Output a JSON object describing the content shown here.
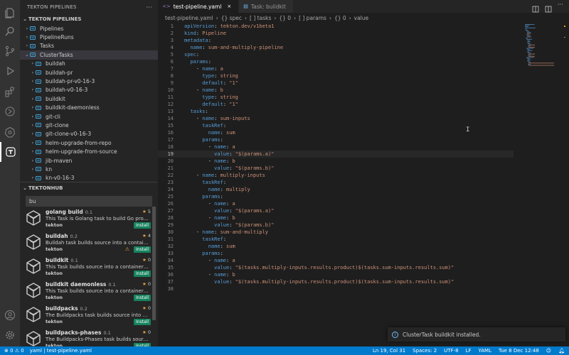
{
  "colors": {
    "accent": "#007acc",
    "install_badge": "#16825d",
    "star": "#e8a33d",
    "tree_icon": "#3ea3d8",
    "yaml_key": "#569cd6",
    "yaml_string": "#ce9178"
  },
  "sidebar": {
    "explorer_title": "TEKTON PIPELINES",
    "tree": [
      {
        "label": "Pipelines",
        "level": 1,
        "expanded": false
      },
      {
        "label": "PipelineRuns",
        "level": 1,
        "expanded": false
      },
      {
        "label": "Tasks",
        "level": 1,
        "expanded": false
      },
      {
        "label": "ClusterTasks",
        "level": 1,
        "expanded": true,
        "selected": true
      },
      {
        "label": "buildah",
        "level": 2
      },
      {
        "label": "buildah-pr",
        "level": 2
      },
      {
        "label": "buildah-pr-v0-16-3",
        "level": 2
      },
      {
        "label": "buildah-v0-16-3",
        "level": 2
      },
      {
        "label": "buildkit",
        "level": 2
      },
      {
        "label": "buildkit-daemonless",
        "level": 2
      },
      {
        "label": "git-cli",
        "level": 2
      },
      {
        "label": "git-clone",
        "level": 2
      },
      {
        "label": "git-clone-v0-16-3",
        "level": 2
      },
      {
        "label": "helm-upgrade-from-repo",
        "level": 2
      },
      {
        "label": "helm-upgrade-from-source",
        "level": 2
      },
      {
        "label": "jib-maven",
        "level": 2
      },
      {
        "label": "kn",
        "level": 2
      },
      {
        "label": "kn-v0-16-3",
        "level": 2
      }
    ],
    "hub": {
      "title": "TEKTONHUB",
      "search_value": "bu",
      "items": [
        {
          "name": "golang build",
          "version": "0.1",
          "rating": "5",
          "desc": "This Task is Golang task to build Go proj...",
          "publisher": "tekton",
          "install": "Install",
          "warning": false
        },
        {
          "name": "buildah",
          "version": "0.2",
          "rating": "4",
          "desc": "Buildah task builds source into a contain...",
          "publisher": "tekton",
          "install": "Install",
          "warning": true
        },
        {
          "name": "buildkit",
          "version": "0.1",
          "rating": "0",
          "desc": "This Task builds source into a container i...",
          "publisher": "tekton",
          "install": "Install",
          "warning": false
        },
        {
          "name": "buildkit daemonless",
          "version": "0.1",
          "rating": "0",
          "desc": "This Task builds source into a container i...",
          "publisher": "tekton",
          "install": "Install",
          "warning": false
        },
        {
          "name": "buildpacks",
          "version": "0.2",
          "rating": "0",
          "desc": "The Buildpacks task builds source into a ...",
          "publisher": "tekton",
          "install": "Install",
          "warning": false
        },
        {
          "name": "buildpacks-phases",
          "version": "0.1",
          "rating": "0",
          "desc": "The Buildpacks-Phases task builds source ...",
          "publisher": "tekton",
          "install": "Install",
          "warning": false
        }
      ]
    }
  },
  "editor": {
    "tabs": [
      {
        "label": "test-pipeline.yaml",
        "active": true
      },
      {
        "label": "Task: buildkit",
        "active": false
      }
    ],
    "breadcrumbs": [
      "test-pipeline.yaml",
      "{} spec",
      "[ ] tasks",
      "{} 0",
      "[ ] params",
      "{} 0",
      "value"
    ],
    "breadcrumb_seps": [
      "›",
      "›",
      "›",
      "›",
      "›",
      "›"
    ],
    "current_line": 19,
    "lines": [
      "apiVersion: tekton.dev/v1beta1",
      "kind: Pipeline",
      "metadata:",
      "  name: sum-and-multiply-pipeline",
      "spec:",
      "  params:",
      "    - name: a",
      "      type: string",
      "      default: \"1\"",
      "    - name: b",
      "      type: string",
      "      default: \"1\"",
      "  tasks:",
      "    - name: sum-inputs",
      "      taskRef:",
      "        name: sum",
      "      params:",
      "        - name: a",
      "          value: \"$(params.a)\"",
      "        - name: b",
      "          value: \"$(params.b)\"",
      "    - name: multiply-inputs",
      "      taskRef:",
      "        name: multiply",
      "      params:",
      "        - name: a",
      "          value: \"$(params.a)\"",
      "        - name: b",
      "          value: \"$(params.b)\"",
      "    - name: sum-and-multiply",
      "      taskRef:",
      "        name: sum",
      "      params:",
      "        - name: a",
      "          value: \"$(tasks.multiply-inputs.results.product)$(tasks.sum-inputs.results.sum)\"",
      "        - name: b",
      "          value: \"$(tasks.multiply-inputs.results.product)$(tasks.sum-inputs.results.sum)\"",
      ""
    ]
  },
  "notification": {
    "text": "ClusterTask buildkit installed."
  },
  "statusbar": {
    "problems": "⊗ 0 ⚠ 0",
    "language_file": "yaml | test-pipeline.yaml",
    "cursor": "Ln 19, Col 31",
    "spaces": "Spaces: 2",
    "encoding": "UTF-8",
    "eol": "LF",
    "language": "YAML",
    "clock": "Tue 8 Dec 12:48"
  }
}
